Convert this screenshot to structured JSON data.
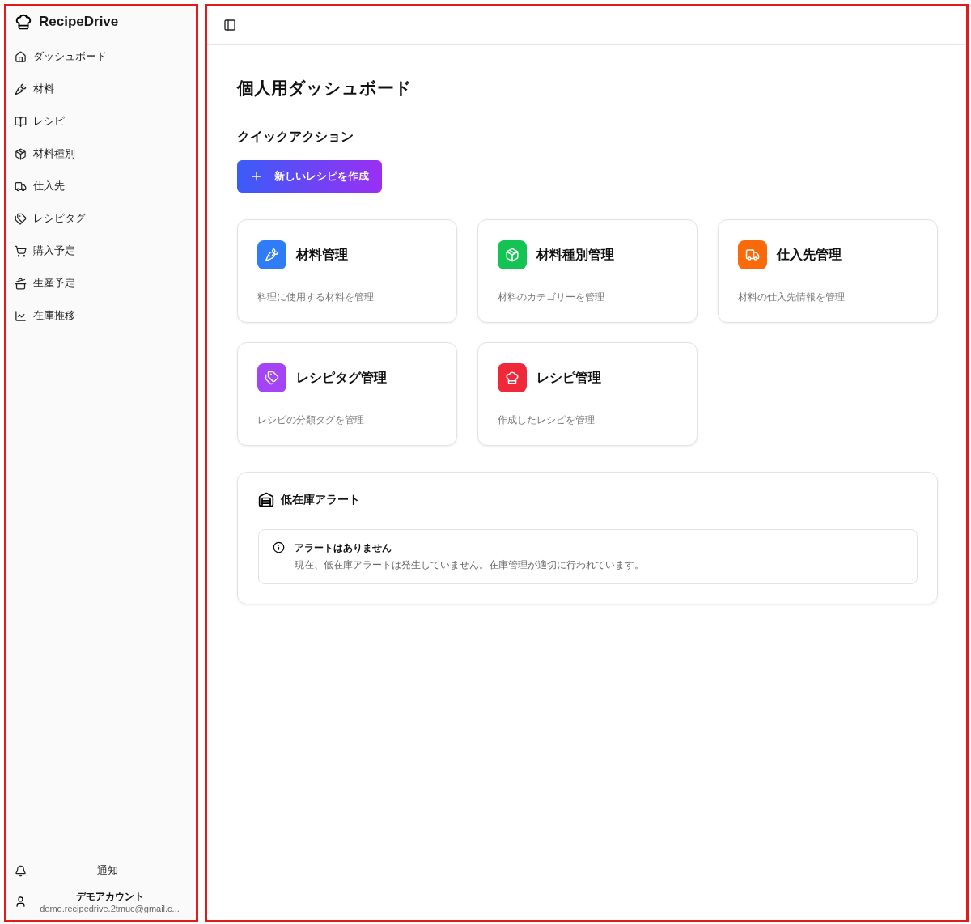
{
  "sidebar": {
    "brand": "RecipeDrive",
    "items": [
      {
        "label": "ダッシュボード",
        "kind": "home"
      },
      {
        "label": "材料",
        "kind": "carrot"
      },
      {
        "label": "レシピ",
        "kind": "book"
      },
      {
        "label": "材料種別",
        "kind": "package"
      },
      {
        "label": "仕入先",
        "kind": "truck"
      },
      {
        "label": "レシピタグ",
        "kind": "tags"
      },
      {
        "label": "購入予定",
        "kind": "cart"
      },
      {
        "label": "生産予定",
        "kind": "pot"
      },
      {
        "label": "在庫推移",
        "kind": "chart"
      }
    ],
    "notifications": "通知",
    "account": {
      "name": "デモアカウント",
      "email": "demo.recipedrive.2tmuc@gmail.c..."
    }
  },
  "page_title": "個人用ダッシュボード",
  "quick_actions": {
    "title": "クイックアクション",
    "button": "新しいレシピを作成"
  },
  "cards": [
    {
      "title": "材料管理",
      "description": "料理に使用する材料を管理",
      "kind": "carrot",
      "color": "#2f7cf6"
    },
    {
      "title": "材料種別管理",
      "description": "材料のカテゴリーを管理",
      "kind": "package",
      "color": "#14c353"
    },
    {
      "title": "仕入先管理",
      "description": "材料の仕入先情報を管理",
      "kind": "truck",
      "color": "#fb6a0a"
    },
    {
      "title": "レシピタグ管理",
      "description": "レシピの分類タグを管理",
      "kind": "tags",
      "color": "#a544f6"
    },
    {
      "title": "レシピ管理",
      "description": "作成したレシピを管理",
      "kind": "chef",
      "color": "#f0293a"
    }
  ],
  "low_stock": {
    "title": "低在庫アラート",
    "alert_title": "アラートはありません",
    "alert_text": "現在、低在庫アラートは発生していません。在庫管理が適切に行われています。"
  }
}
